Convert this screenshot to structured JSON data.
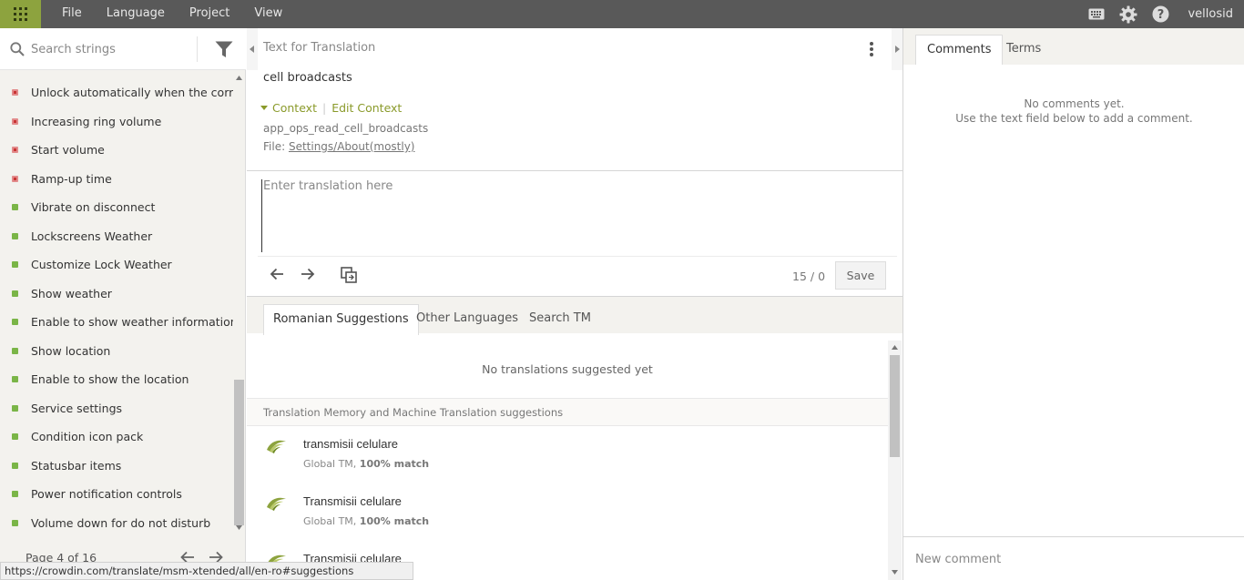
{
  "menu": [
    "File",
    "Language",
    "Project",
    "View"
  ],
  "user": "vellosid",
  "search": {
    "placeholder": "Search strings"
  },
  "strings": [
    {
      "label": "Unlock automatically when the corr...",
      "status": "untranslated"
    },
    {
      "label": "Increasing ring volume",
      "status": "untranslated"
    },
    {
      "label": "Start volume",
      "status": "untranslated"
    },
    {
      "label": "Ramp-up time",
      "status": "untranslated"
    },
    {
      "label": "Vibrate on disconnect",
      "status": "translated"
    },
    {
      "label": "Lockscreens Weather",
      "status": "translated"
    },
    {
      "label": "Customize Lock Weather",
      "status": "translated"
    },
    {
      "label": "Show weather",
      "status": "translated"
    },
    {
      "label": "Enable to show weather information",
      "status": "translated"
    },
    {
      "label": "Show location",
      "status": "translated"
    },
    {
      "label": "Enable to show the location",
      "status": "translated"
    },
    {
      "label": "Service settings",
      "status": "translated"
    },
    {
      "label": "Condition icon pack",
      "status": "translated"
    },
    {
      "label": "Statusbar items",
      "status": "translated"
    },
    {
      "label": "Power notification controls",
      "status": "translated"
    },
    {
      "label": "Volume down for do not disturb",
      "status": "translated"
    }
  ],
  "pager": {
    "label": "Page 4 of 16"
  },
  "source": {
    "title": "Text for Translation",
    "text": "cell broadcasts",
    "context_label": "Context",
    "edit_context_label": "Edit Context",
    "key": "app_ops_read_cell_broadcasts",
    "file_prefix": "File:",
    "file_name": "Settings/About(mostly)"
  },
  "translation": {
    "placeholder": "Enter translation here",
    "counter": "15 / 0",
    "save_label": "Save"
  },
  "suggestion_tabs": [
    "Romanian Suggestions",
    "Other Languages",
    "Search TM"
  ],
  "suggestions": {
    "empty_text": "No translations suggested yet",
    "tm_header": "Translation Memory and Machine Translation suggestions",
    "items": [
      {
        "text": "transmisii celulare",
        "source": "Global TM,",
        "match": "100% match"
      },
      {
        "text": "Transmisii celulare",
        "source": "Global TM,",
        "match": "100% match"
      },
      {
        "text": "Transmisii celulare",
        "source": "",
        "match": ""
      }
    ]
  },
  "right_tabs": [
    "Comments",
    "Terms"
  ],
  "comments": {
    "empty_line1": "No comments yet.",
    "empty_line2": "Use the text field below to add a comment.",
    "input_placeholder": "New comment"
  },
  "status_url": "https://crowdin.com/translate/msm-xtended/all/en-ro#suggestions",
  "colors": {
    "brand_green": "#8da33e",
    "topbar": "#595959",
    "untranslated": "#c93434",
    "translated": "#7ab547",
    "context_link": "#8a9a2a"
  }
}
